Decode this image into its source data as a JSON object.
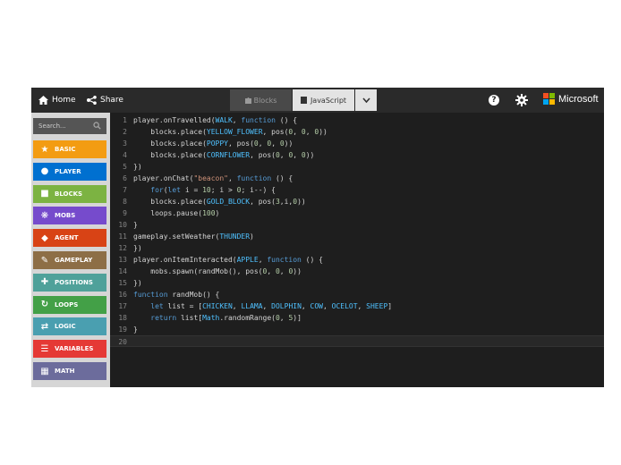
{
  "header": {
    "home_label": "Home",
    "share_label": "Share",
    "tab_blocks": "Blocks",
    "tab_javascript": "JavaScript",
    "help_label": "?",
    "brand": "Microsoft",
    "brand_colors": [
      "#f25022",
      "#7fba00",
      "#00a4ef",
      "#ffb900"
    ]
  },
  "toolbox": {
    "search_placeholder": "Search...",
    "categories": [
      {
        "label": "BASIC",
        "color": "#f39c12",
        "icon": "star-icon"
      },
      {
        "label": "PLAYER",
        "color": "#0070d0",
        "icon": "person-icon"
      },
      {
        "label": "BLOCKS",
        "color": "#7cb342",
        "icon": "cube-icon"
      },
      {
        "label": "MOBS",
        "color": "#764bcc",
        "icon": "paw-icon"
      },
      {
        "label": "AGENT",
        "color": "#d84315",
        "icon": "agent-icon"
      },
      {
        "label": "GAMEPLAY",
        "color": "#8d6e46",
        "icon": "wrench-icon"
      },
      {
        "label": "POSITIONS",
        "color": "#4fa19a",
        "icon": "crosshair-icon"
      },
      {
        "label": "LOOPS",
        "color": "#43a047",
        "icon": "refresh-icon"
      },
      {
        "label": "LOGIC",
        "color": "#4a9fb0",
        "icon": "shuffle-icon"
      },
      {
        "label": "VARIABLES",
        "color": "#e53935",
        "icon": "list-icon"
      },
      {
        "label": "MATH",
        "color": "#6c6c9c",
        "icon": "calculator-icon"
      }
    ]
  },
  "editor": {
    "lines": [
      {
        "n": "1",
        "code": "player.onTravelled(WALK, function () {"
      },
      {
        "n": "2",
        "code": "    blocks.place(YELLOW_FLOWER, pos(0, 0, 0))"
      },
      {
        "n": "3",
        "code": "    blocks.place(POPPY, pos(0, 0, 0))"
      },
      {
        "n": "4",
        "code": "    blocks.place(CORNFLOWER, pos(0, 0, 0))"
      },
      {
        "n": "5",
        "code": "})"
      },
      {
        "n": "6",
        "code": "player.onChat(\"beacon\", function () {"
      },
      {
        "n": "7",
        "code": "    for(let i = 10; i > 0; i--) {"
      },
      {
        "n": "8",
        "code": "    blocks.place(GOLD_BLOCK, pos(3,i,0))"
      },
      {
        "n": "9",
        "code": "    loops.pause(100)"
      },
      {
        "n": "10",
        "code": "}"
      },
      {
        "n": "11",
        "code": "gameplay.setWeather(THUNDER)"
      },
      {
        "n": "12",
        "code": "})"
      },
      {
        "n": "13",
        "code": "player.onItemInteracted(APPLE, function () {"
      },
      {
        "n": "14",
        "code": "    mobs.spawn(randMob(), pos(0, 0, 0))"
      },
      {
        "n": "15",
        "code": "})"
      },
      {
        "n": "16",
        "code": "function randMob() {"
      },
      {
        "n": "17",
        "code": "    let list = [CHICKEN, LLAMA, DOLPHIN, COW, OCELOT, SHEEP]"
      },
      {
        "n": "18",
        "code": "    return list[Math.randomRange(0, 5)]"
      },
      {
        "n": "19",
        "code": "}"
      },
      {
        "n": "20",
        "code": ""
      }
    ]
  }
}
